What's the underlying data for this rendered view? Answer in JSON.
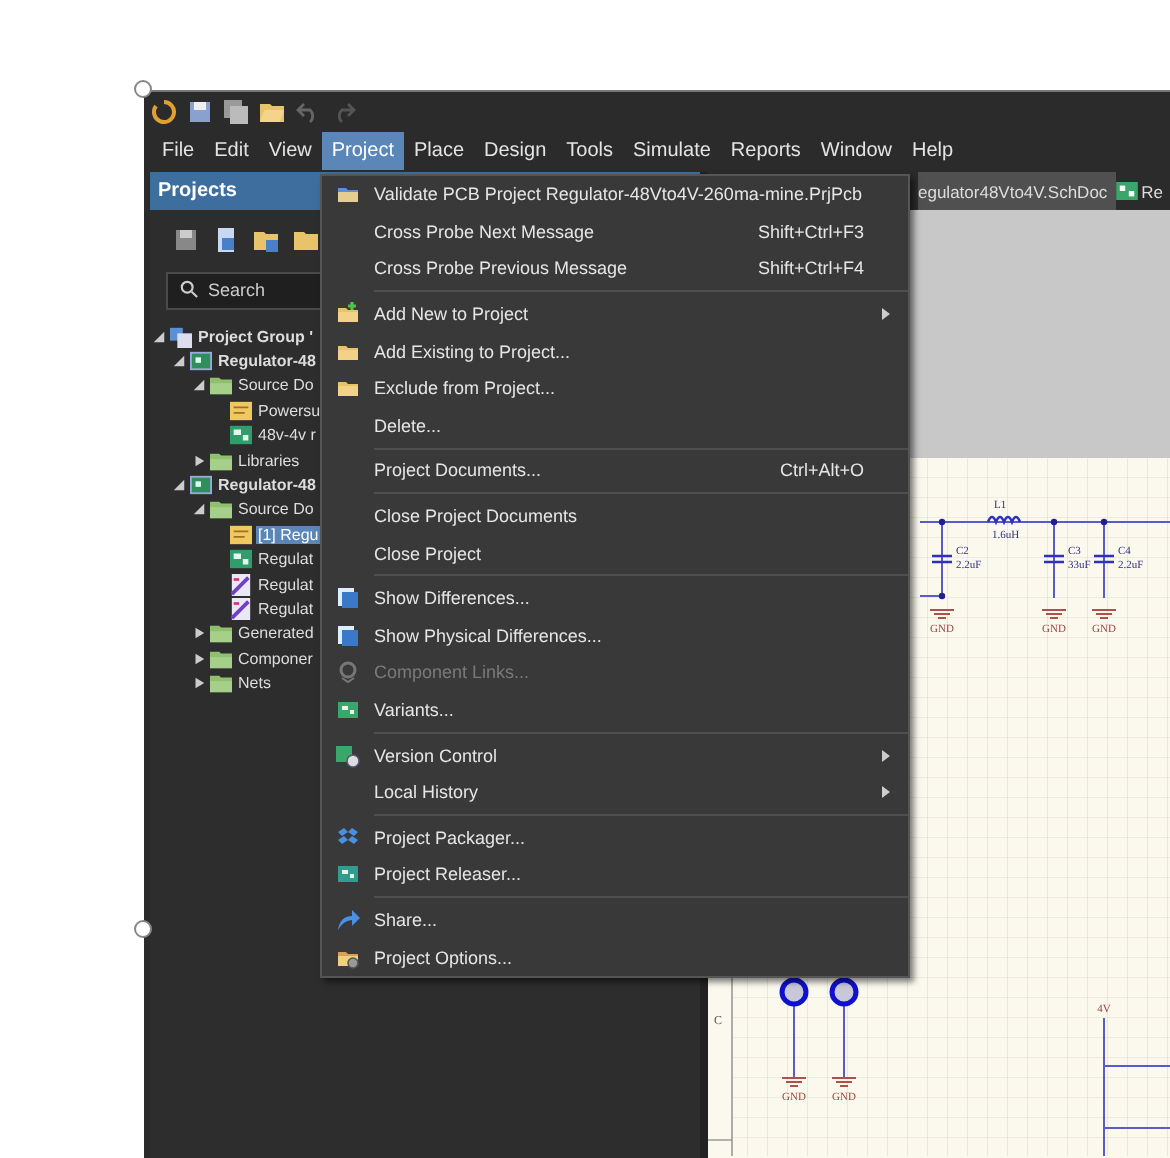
{
  "menu_bar": [
    {
      "label": "File",
      "selected": false
    },
    {
      "label": "Edit",
      "selected": false
    },
    {
      "label": "View",
      "selected": false
    },
    {
      "label": "Project",
      "selected": true
    },
    {
      "label": "Place",
      "selected": false
    },
    {
      "label": "Design",
      "selected": false
    },
    {
      "label": "Tools",
      "selected": false
    },
    {
      "label": "Simulate",
      "selected": false
    },
    {
      "label": "Reports",
      "selected": false
    },
    {
      "label": "Window",
      "selected": false
    },
    {
      "label": "Help",
      "selected": false
    }
  ],
  "projects_panel": {
    "title": "Projects",
    "search": {
      "placeholder": "Search"
    },
    "tree": [
      {
        "kind": "group",
        "label": "Project Group '",
        "expanded": true,
        "selected": false,
        "children": [
          {
            "kind": "project",
            "label": "Regulator-48",
            "expanded": true,
            "selected": false,
            "children": [
              {
                "kind": "folder",
                "label": "Source Do",
                "expanded": true,
                "selected": false,
                "children": [
                  {
                    "kind": "schematic",
                    "label": "Powersu",
                    "selected": false
                  },
                  {
                    "kind": "pcb",
                    "label": "48v-4v r",
                    "selected": false
                  }
                ]
              },
              {
                "kind": "folder",
                "label": "Libraries",
                "expanded": false,
                "selected": false
              }
            ]
          },
          {
            "kind": "project",
            "label": "Regulator-48",
            "expanded": true,
            "selected": false,
            "children": [
              {
                "kind": "folder",
                "label": "Source Do",
                "expanded": true,
                "selected": false,
                "children": [
                  {
                    "kind": "schematic",
                    "label": "[1] Regu",
                    "selected": true
                  },
                  {
                    "kind": "pcb",
                    "label": "Regulat",
                    "selected": false
                  },
                  {
                    "kind": "harness",
                    "label": "Regulat",
                    "selected": false
                  },
                  {
                    "kind": "harness",
                    "label": "Regulat",
                    "selected": false
                  }
                ]
              },
              {
                "kind": "folder",
                "label": "Generated",
                "expanded": false,
                "selected": false
              },
              {
                "kind": "folder",
                "label": "Componer",
                "expanded": false,
                "selected": false
              },
              {
                "kind": "folder",
                "label": "Nets",
                "expanded": false,
                "selected": false
              }
            ]
          }
        ]
      }
    ]
  },
  "document_tabs": [
    {
      "label": "egulator48Vto4V.SchDoc",
      "selected": true
    },
    {
      "label": "Re",
      "selected": false
    }
  ],
  "schematic": {
    "labels": [
      "L1",
      "1.6uH",
      "C2",
      "2.2uF",
      "C3",
      "33uF",
      "C4",
      "2.2uF"
    ],
    "grounds": [
      "GND",
      "GND",
      "GND",
      "GND",
      "GND"
    ],
    "net_label": "4V",
    "zone": "C"
  },
  "project_menu": [
    {
      "kind": "item",
      "label": "Validate PCB Project Regulator-48Vto4V-260ma-mine.PrjPcb",
      "submenu": false,
      "disabled": false
    },
    {
      "kind": "item",
      "label": "Cross Probe Next Message",
      "shortcut": "Shift+Ctrl+F3",
      "submenu": false,
      "disabled": false
    },
    {
      "kind": "item",
      "label": "Cross Probe Previous Message",
      "shortcut": "Shift+Ctrl+F4",
      "submenu": false,
      "disabled": false
    },
    {
      "kind": "separator"
    },
    {
      "kind": "item",
      "label": "Add New to Project",
      "submenu": true,
      "disabled": false
    },
    {
      "kind": "item",
      "label": "Add Existing to Project...",
      "submenu": false,
      "disabled": false
    },
    {
      "kind": "item",
      "label": "Exclude from Project...",
      "submenu": false,
      "disabled": false
    },
    {
      "kind": "item",
      "label": "Delete...",
      "submenu": false,
      "disabled": false
    },
    {
      "kind": "separator"
    },
    {
      "kind": "item",
      "label": "Project Documents...",
      "shortcut": "Ctrl+Alt+O",
      "submenu": false,
      "disabled": false
    },
    {
      "kind": "separator"
    },
    {
      "kind": "item",
      "label": "Close Project Documents",
      "submenu": false,
      "disabled": false
    },
    {
      "kind": "item",
      "label": "Close Project",
      "submenu": false,
      "disabled": false
    },
    {
      "kind": "separator"
    },
    {
      "kind": "item",
      "label": "Show Differences...",
      "submenu": false,
      "disabled": false
    },
    {
      "kind": "item",
      "label": "Show Physical Differences...",
      "submenu": false,
      "disabled": false
    },
    {
      "kind": "item",
      "label": "Component Links...",
      "submenu": false,
      "disabled": true
    },
    {
      "kind": "item",
      "label": "Variants...",
      "submenu": false,
      "disabled": false
    },
    {
      "kind": "separator"
    },
    {
      "kind": "item",
      "label": "Version Control",
      "submenu": true,
      "disabled": false
    },
    {
      "kind": "item",
      "label": "Local History",
      "submenu": true,
      "disabled": false
    },
    {
      "kind": "separator"
    },
    {
      "kind": "item",
      "label": "Project Packager...",
      "submenu": false,
      "disabled": false
    },
    {
      "kind": "item",
      "label": "Project Releaser...",
      "submenu": false,
      "disabled": false
    },
    {
      "kind": "separator"
    },
    {
      "kind": "item",
      "label": "Share...",
      "submenu": false,
      "disabled": false
    },
    {
      "kind": "item",
      "label": "Project Options...",
      "submenu": false,
      "disabled": false
    }
  ]
}
